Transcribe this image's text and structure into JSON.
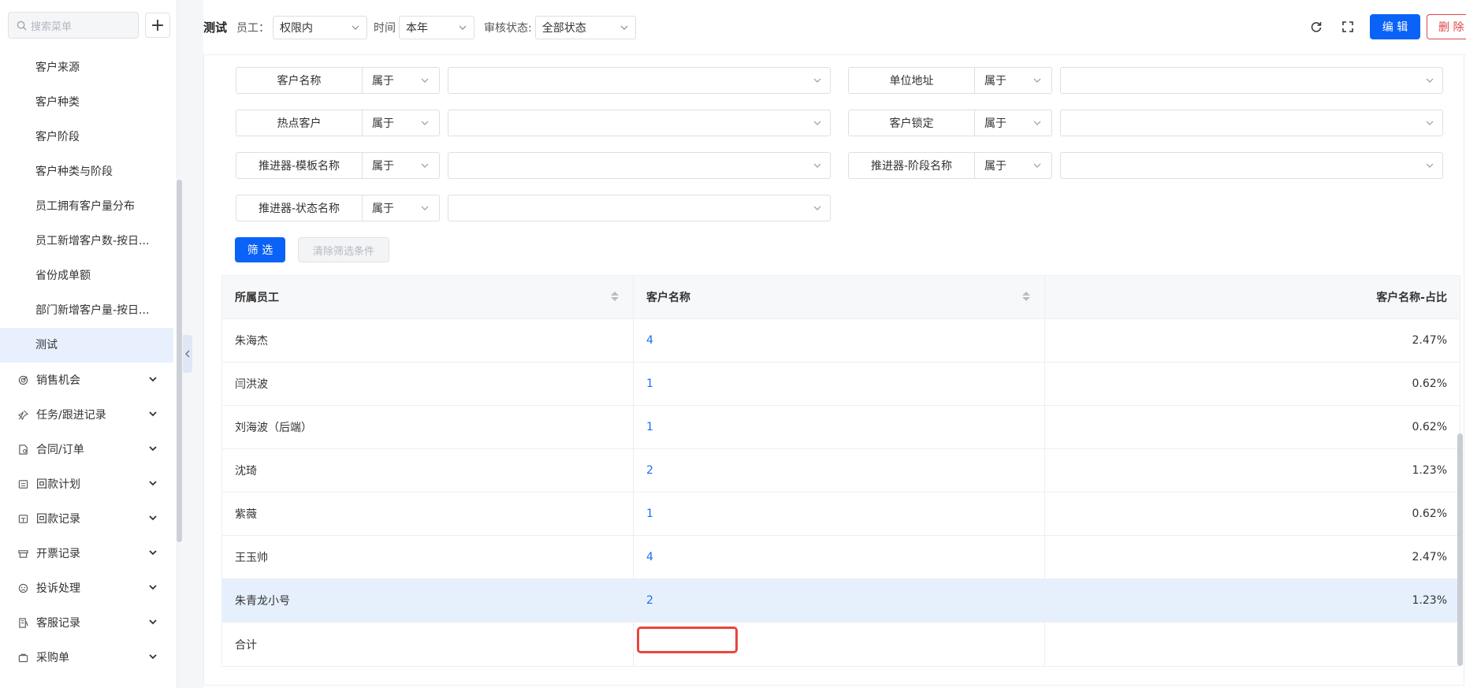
{
  "sidebar": {
    "search_placeholder": "搜索菜单",
    "add_label": "+",
    "sub_items": [
      {
        "label": "客户来源"
      },
      {
        "label": "客户种类"
      },
      {
        "label": "客户阶段"
      },
      {
        "label": "客户种类与阶段"
      },
      {
        "label": "员工拥有客户量分布"
      },
      {
        "label": "员工新增客户数-按日..."
      },
      {
        "label": "省份成单额"
      },
      {
        "label": "部门新增客户量-按日..."
      },
      {
        "label": "测试",
        "active": true
      }
    ],
    "menus": [
      {
        "label": "销售机会",
        "icon": "target-icon"
      },
      {
        "label": "任务/跟进记录",
        "icon": "pin-icon"
      },
      {
        "label": "合同/订单",
        "icon": "contract-icon"
      },
      {
        "label": "回款计划",
        "icon": "payment-plan-icon"
      },
      {
        "label": "回款记录",
        "icon": "payment-record-icon"
      },
      {
        "label": "开票记录",
        "icon": "invoice-icon"
      },
      {
        "label": "投诉处理",
        "icon": "complaint-icon"
      },
      {
        "label": "客服记录",
        "icon": "service-icon"
      },
      {
        "label": "采购单",
        "icon": "purchase-icon"
      }
    ]
  },
  "toolbar": {
    "title": "测试",
    "employee_label": "员工：",
    "employee_value": "权限内",
    "time_label": "时间",
    "time_value": "本年",
    "audit_label": "审核状态:",
    "audit_value": "全部状态",
    "edit_label": "编 辑",
    "delete_label": "删 除"
  },
  "filters": [
    {
      "field": "客户名称",
      "op": "属于",
      "value": ""
    },
    {
      "field": "单位地址",
      "op": "属于",
      "value": ""
    },
    {
      "field": "热点客户",
      "op": "属于",
      "value": ""
    },
    {
      "field": "客户锁定",
      "op": "属于",
      "value": ""
    },
    {
      "field": "推进器-模板名称",
      "op": "属于",
      "value": ""
    },
    {
      "field": "推进器-阶段名称",
      "op": "属于",
      "value": ""
    },
    {
      "field": "推进器-状态名称",
      "op": "属于",
      "value": ""
    }
  ],
  "filter_buttons": {
    "apply": "筛 选",
    "clear": "清除筛选条件"
  },
  "table": {
    "headers": [
      "所属员工",
      "客户名称",
      "客户名称-占比"
    ],
    "rows": [
      {
        "employee": "朱海杰",
        "count": "4",
        "ratio": "2.47%"
      },
      {
        "employee": "闫洪波",
        "count": "1",
        "ratio": "0.62%"
      },
      {
        "employee": "刘海波（后端）",
        "count": "1",
        "ratio": "0.62%"
      },
      {
        "employee": "沈琦",
        "count": "2",
        "ratio": "1.23%"
      },
      {
        "employee": "紫薇",
        "count": "1",
        "ratio": "0.62%"
      },
      {
        "employee": "王玉帅",
        "count": "4",
        "ratio": "2.47%"
      },
      {
        "employee": "朱青龙小号",
        "count": "2",
        "ratio": "1.23%",
        "highlight": true
      }
    ],
    "total_label": "合计",
    "total_count": "",
    "total_ratio": ""
  },
  "colors": {
    "primary": "#0a63f6",
    "danger": "#e04444",
    "highlight": "#e6f0fc",
    "link": "#1a6ef5"
  }
}
